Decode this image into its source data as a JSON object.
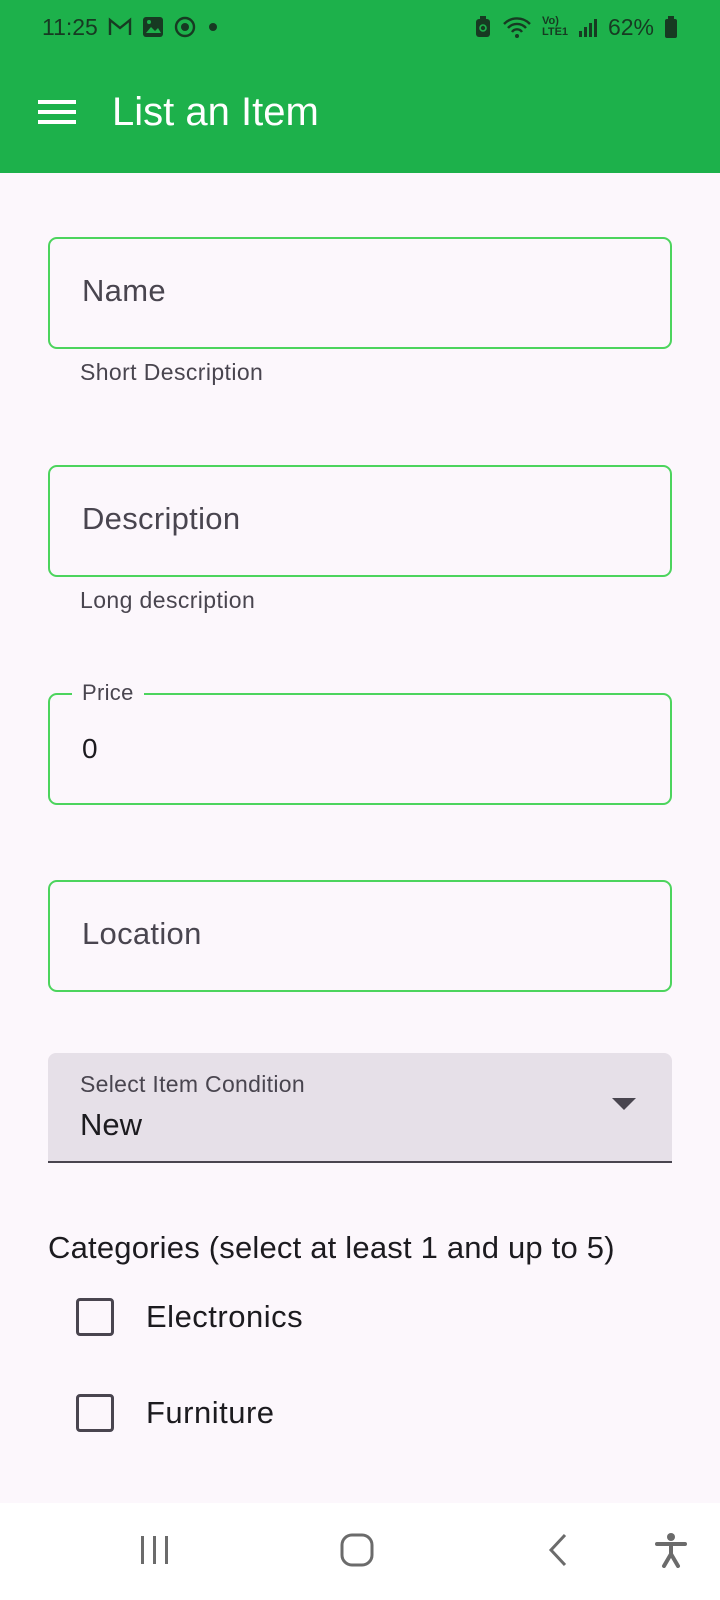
{
  "status_bar": {
    "time": "11:25",
    "battery": "62%",
    "network_label": "Vo) LTE1"
  },
  "app_bar": {
    "title": "List an Item"
  },
  "form": {
    "name": {
      "label": "Name",
      "helper": "Short Description"
    },
    "description": {
      "label": "Description",
      "helper": "Long description"
    },
    "price": {
      "label": "Price",
      "value": "0"
    },
    "location": {
      "label": "Location"
    },
    "condition": {
      "label": "Select Item Condition",
      "value": "New"
    },
    "categories": {
      "title": "Categories (select at least 1 and up to 5)",
      "items": [
        {
          "label": "Electronics",
          "checked": false
        },
        {
          "label": "Furniture",
          "checked": false
        }
      ]
    }
  },
  "colors": {
    "primary": "#1db14b",
    "field_border": "#4cd45d",
    "background": "#fcf7fc"
  }
}
